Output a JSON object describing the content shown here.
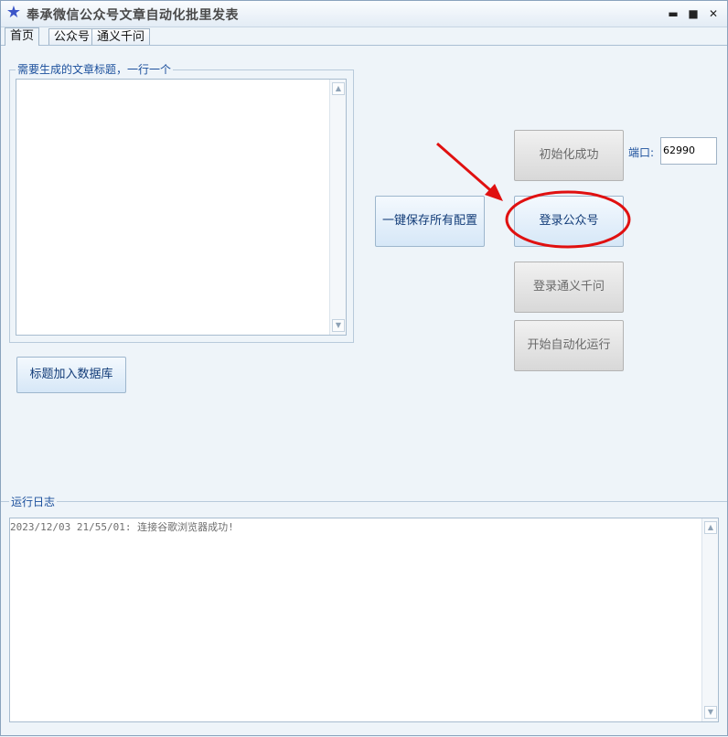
{
  "window": {
    "title": "奉承微信公众号文章自动化批里发表",
    "icon": "star-icon",
    "controls": {
      "minimize": "▬",
      "maximize": "■",
      "close": "✕"
    }
  },
  "tabs": [
    {
      "label": "首页",
      "active": true
    },
    {
      "label": "公众号",
      "active": false
    },
    {
      "label": "通义千问",
      "active": false
    }
  ],
  "titles_group": {
    "label": "需要生成的文章标题，一行一个",
    "value": ""
  },
  "buttons": {
    "add_titles": "标题加入数据库",
    "save_config": "一键保存所有配置",
    "init": "初始化成功",
    "login_wechat": "登录公众号",
    "login_tongyi": "登录通义千问",
    "start_auto": "开始自动化运行"
  },
  "port": {
    "label": "端口:",
    "value": "62990"
  },
  "log": {
    "label": "运行日志",
    "lines": [
      "2023/12/03 21/55/01: 连接谷歌浏览器成功!"
    ]
  },
  "colors": {
    "annotation": "#e01010",
    "accent": "#1b4f9c"
  }
}
